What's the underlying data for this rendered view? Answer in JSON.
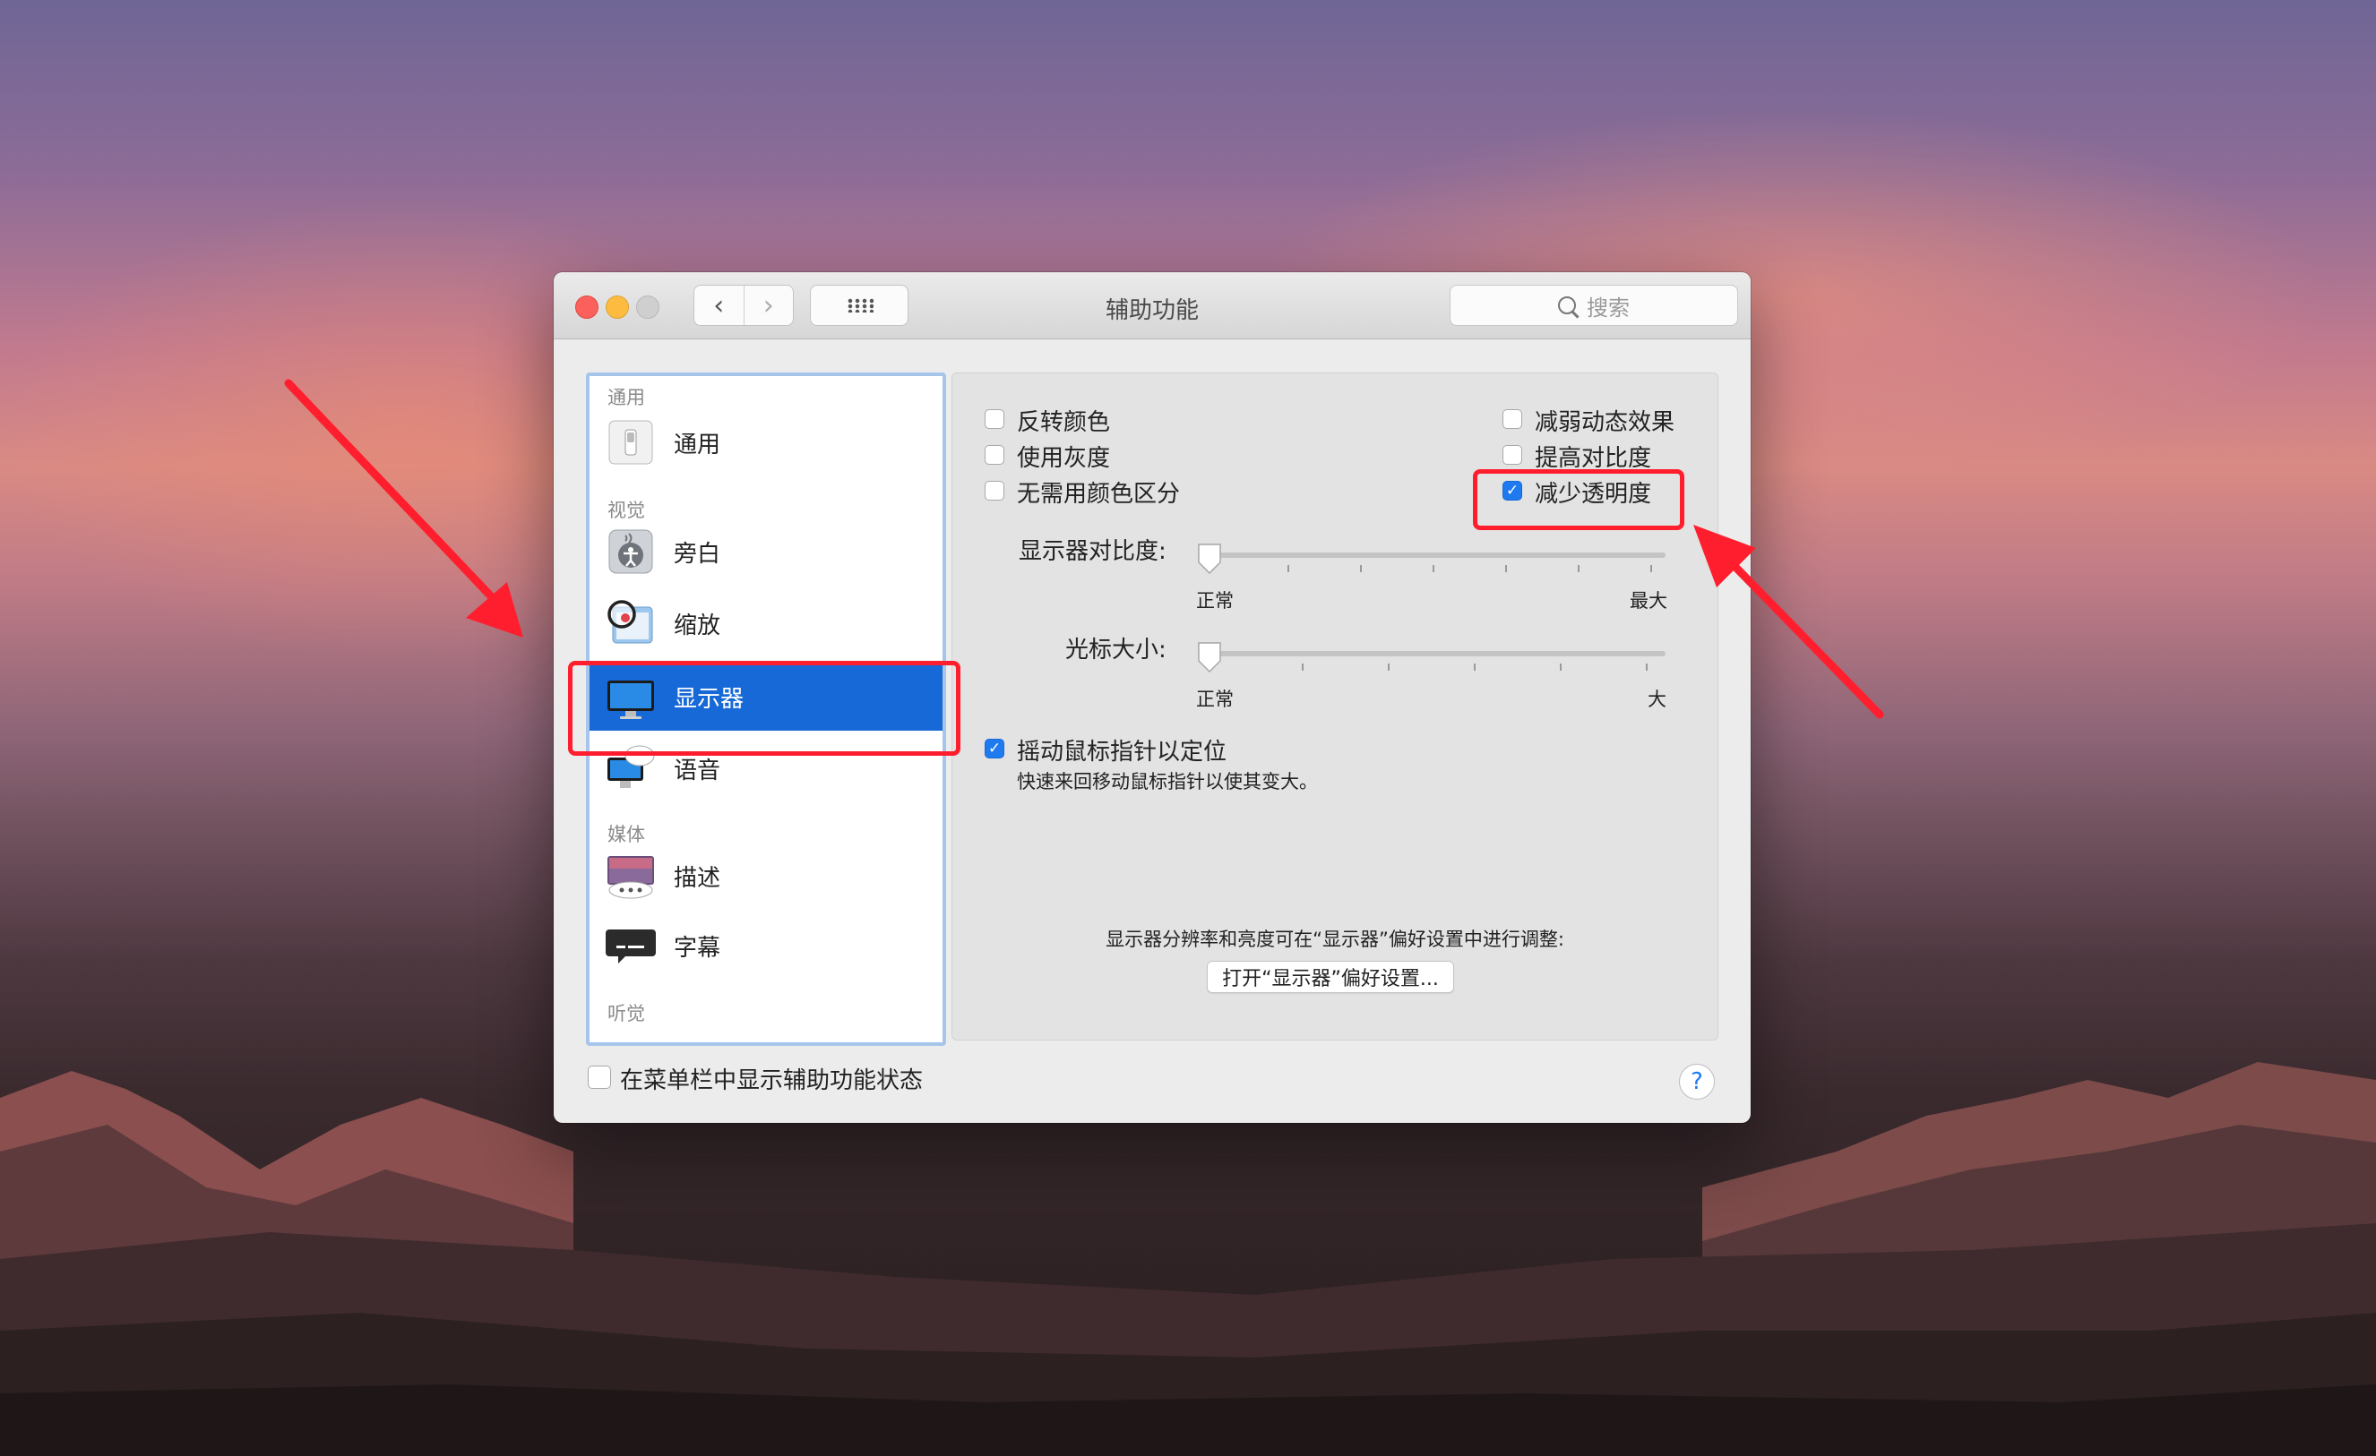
{
  "window": {
    "title": "辅助功能",
    "search_placeholder": "搜索",
    "back_symbol": "‹",
    "forward_symbol": "›"
  },
  "sidebar": {
    "sections": [
      "通用",
      "视觉",
      "媒体",
      "听觉"
    ],
    "items": [
      {
        "label": "通用",
        "icon": "general-switch-icon"
      },
      {
        "label": "旁白",
        "icon": "voiceover-icon"
      },
      {
        "label": "缩放",
        "icon": "zoom-icon"
      },
      {
        "label": "显示器",
        "icon": "display-icon",
        "selected": true
      },
      {
        "label": "语音",
        "icon": "speech-icon"
      },
      {
        "label": "描述",
        "icon": "descriptions-icon"
      },
      {
        "label": "字幕",
        "icon": "captions-icon"
      }
    ]
  },
  "display": {
    "invert_colors": {
      "label": "反转颜色",
      "checked": false
    },
    "grayscale": {
      "label": "使用灰度",
      "checked": false
    },
    "differentiate": {
      "label": "无需用颜色区分",
      "checked": false
    },
    "reduce_motion": {
      "label": "减弱动态效果",
      "checked": false
    },
    "increase_contrast": {
      "label": "提高对比度",
      "checked": false
    },
    "reduce_transparency": {
      "label": "减少透明度",
      "checked": true
    },
    "contrast_slider": {
      "label": "显示器对比度:",
      "min_label": "正常",
      "max_label": "最大",
      "value": 0
    },
    "cursor_slider": {
      "label": "光标大小:",
      "min_label": "正常",
      "max_label": "大",
      "value": 0
    },
    "shake_cursor": {
      "label": "摇动鼠标指针以定位",
      "checked": true,
      "description": "快速来回移动鼠标指针以使其变大。"
    },
    "note": "显示器分辨率和亮度可在“显示器”偏好设置中进行调整:",
    "open_button": "打开“显示器”偏好设置..."
  },
  "footer": {
    "menubar_status": {
      "label": "在菜单栏中显示辅助功能状态",
      "checked": false
    },
    "help": "?"
  },
  "colors": {
    "accent": "#1769d8",
    "highlight": "#ff1e2d"
  }
}
